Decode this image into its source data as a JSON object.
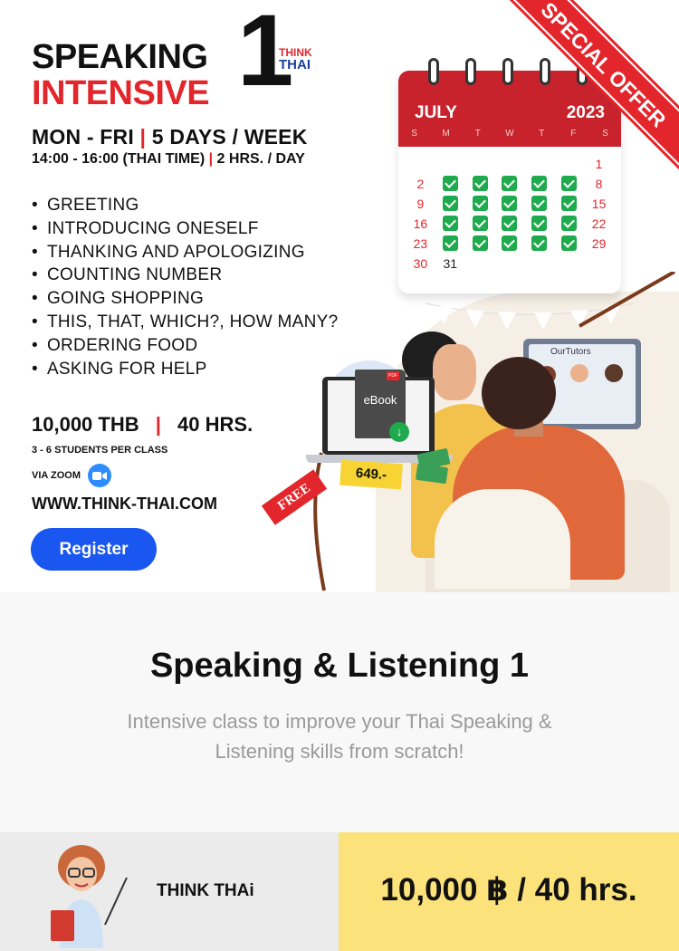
{
  "banner": {
    "title_line1": "SPEAKING",
    "title_line2": "INTENSIVE",
    "level": "1",
    "logo_top": "THINK",
    "logo_bottom": "THAI",
    "ribbon_text": "SPECIAL OFFER",
    "schedule_days": "MON - FRI",
    "schedule_sep": "|",
    "schedule_week": "5 DAYS / WEEK",
    "schedule_time": "14:00 - 16:00  (THAI TIME)",
    "schedule_hours": "2 HRS. / DAY",
    "topics": [
      "GREETING",
      "INTRODUCING ONESELF",
      "THANKING AND APOLOGIZING",
      "COUNTING NUMBER",
      "GOING SHOPPING",
      "THIS, THAT, WHICH?, HOW MANY?",
      "ORDERING FOOD",
      "ASKING FOR HELP"
    ],
    "price": "10,000 THB",
    "duration": "40 HRS.",
    "class_size": "3 - 6  STUDENTS PER CLASS",
    "platform": "VIA ZOOM",
    "website": "WWW.THINK-THAI.COM",
    "register_label": "Register",
    "ebook_label": "eBook",
    "pdf_label": "PDF",
    "ebook_price": "649.-",
    "free_label": "FREE",
    "tutors_label": "OurTutors"
  },
  "calendar": {
    "month": "JULY",
    "year": "2023",
    "weekdays": [
      "S",
      "M",
      "T",
      "W",
      "T",
      "F",
      "S"
    ],
    "rows": [
      [
        "",
        "",
        "",
        "",
        "",
        "",
        "1"
      ],
      [
        "2",
        "✓",
        "✓",
        "✓",
        "✓",
        "✓",
        "8"
      ],
      [
        "9",
        "✓",
        "✓",
        "✓",
        "✓",
        "✓",
        "15"
      ],
      [
        "16",
        "✓",
        "✓",
        "✓",
        "✓",
        "✓",
        "22"
      ],
      [
        "23",
        "✓",
        "✓",
        "✓",
        "✓",
        "✓",
        "29"
      ],
      [
        "30",
        "31",
        "",
        "",
        "",
        "",
        ""
      ]
    ]
  },
  "course": {
    "title": "Speaking & Listening 1",
    "description": "Intensive class to improve your Thai Speaking & Listening skills from scratch!"
  },
  "footer": {
    "brand": "THINK THAi",
    "price": "10,000 ฿ / 40 hrs."
  },
  "colors": {
    "accent_red": "#e3262b",
    "button_blue": "#1a56f0",
    "check_green": "#1faa4d",
    "footer_yellow": "#fbe27a"
  }
}
